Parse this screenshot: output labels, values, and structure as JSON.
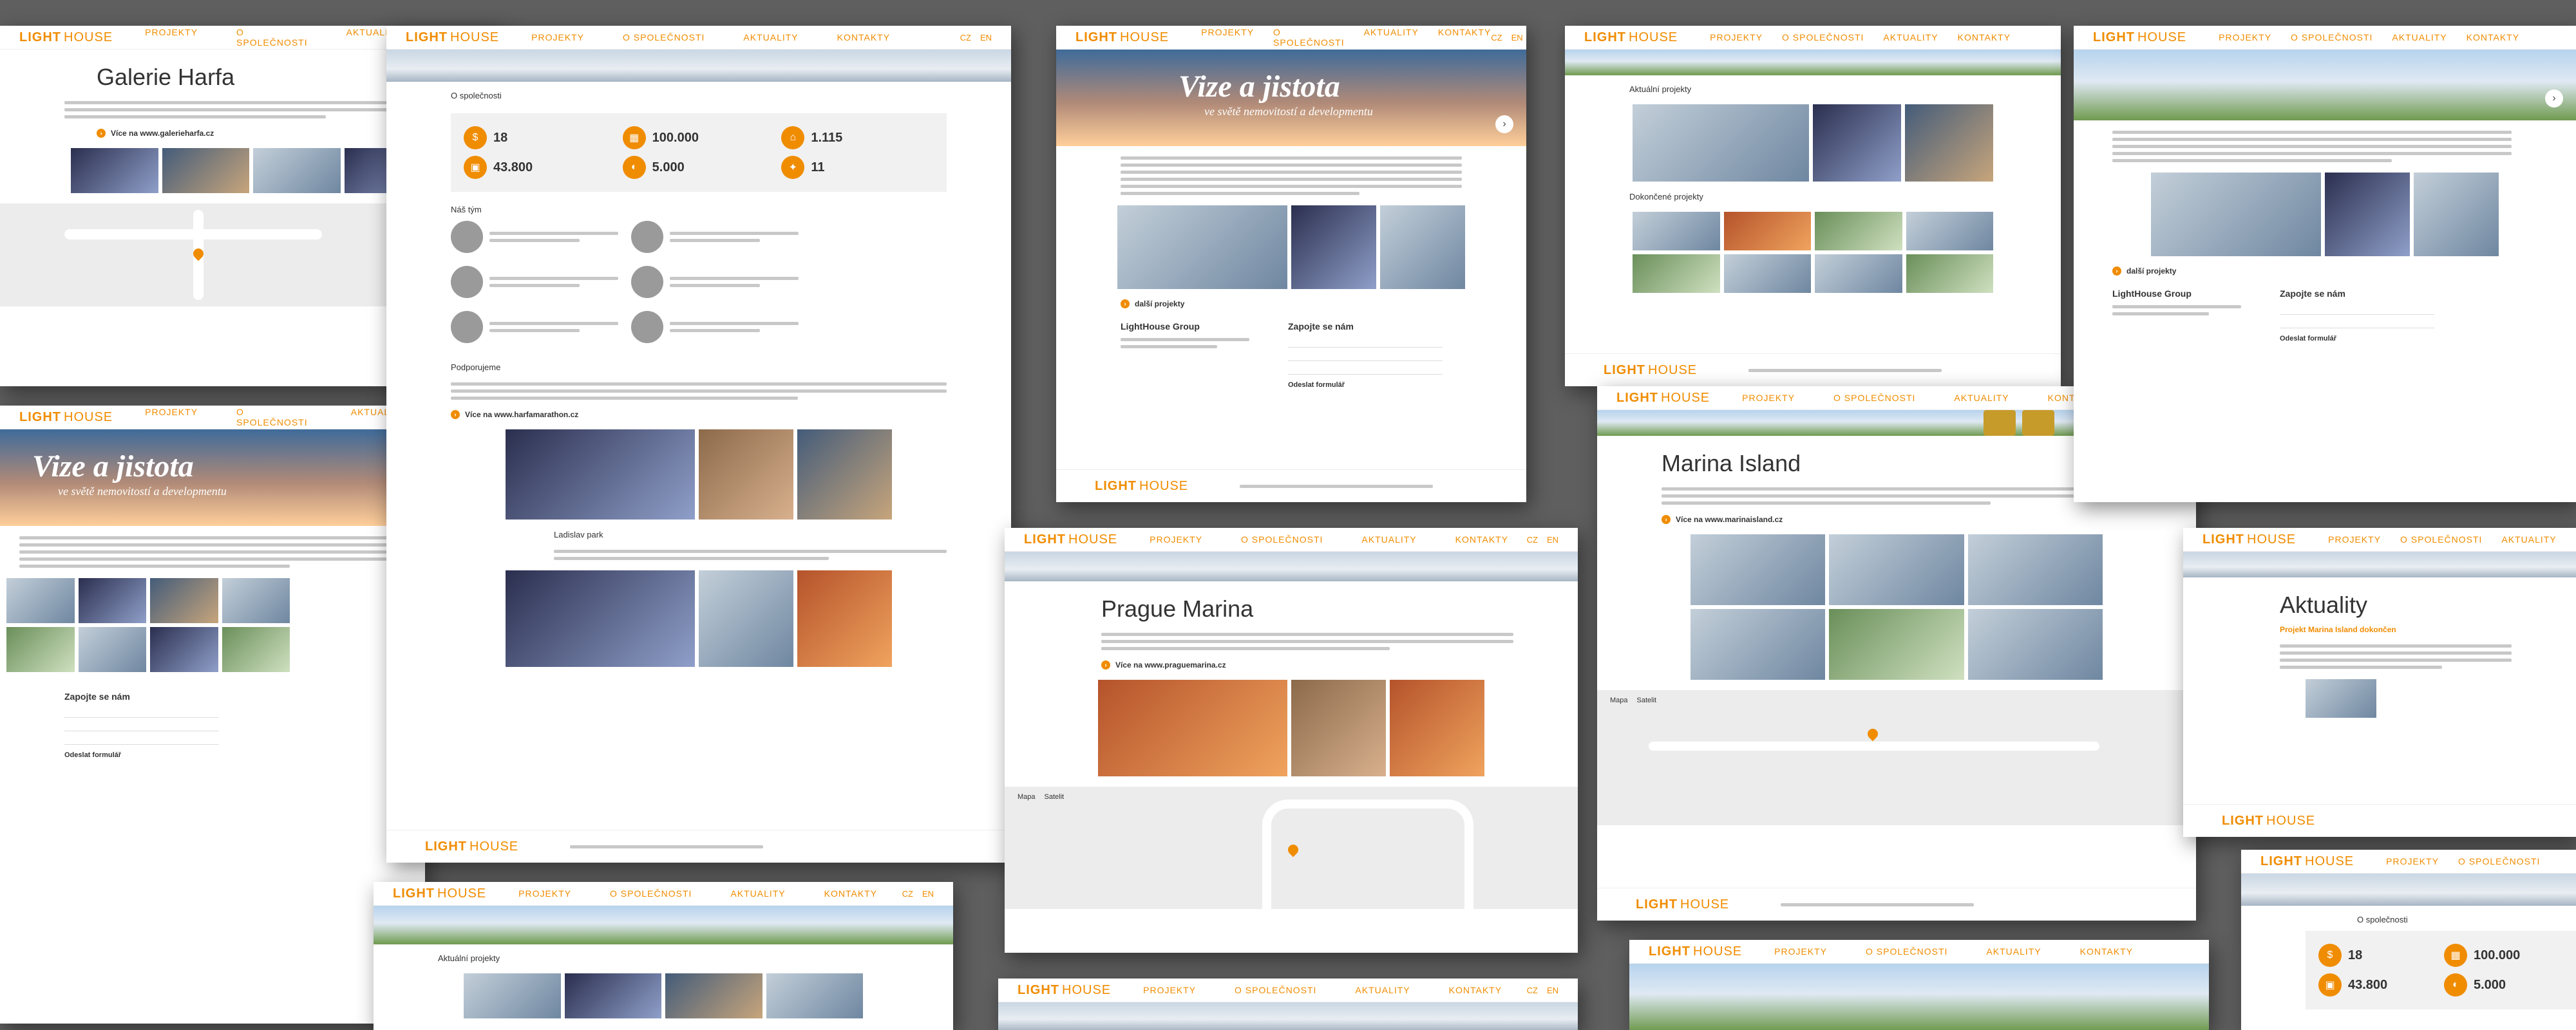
{
  "nav": {
    "logo_light": "LIGHT",
    "logo_house": "HOUSE",
    "menu": [
      "PROJEKTY",
      "O SPOLEČNOSTI",
      "AKTUALITY",
      "KONTAKTY"
    ],
    "lang": [
      "CZ",
      "EN"
    ]
  },
  "hero": {
    "title": "Vize a jistota",
    "subtitle": "ve světě nemovitostí a developmentu"
  },
  "pages": {
    "harfa": {
      "title": "Galerie Harfa",
      "link": "Více na www.galerieharfa.cz"
    },
    "marina": {
      "title": "Prague Marina",
      "link": "Více na www.praguemarina.cz"
    },
    "island": {
      "title": "Marina Island",
      "link": "Více na www.marinaisland.cz"
    },
    "news": {
      "title": "Aktuality",
      "kicker": "Projekt Marina Island dokončen"
    }
  },
  "company": {
    "heading": "O společnosti",
    "team_heading": "Náš tým",
    "stats": [
      {
        "icon": "money-bag-icon",
        "value": "18"
      },
      {
        "icon": "building-icon",
        "value": "100.000"
      },
      {
        "icon": "home-icon",
        "value": "1.115"
      },
      {
        "icon": "briefcase-icon",
        "value": "43.800"
      },
      {
        "icon": "car-icon",
        "value": "5.000"
      },
      {
        "icon": "handshake-icon",
        "value": "11"
      }
    ],
    "sponsoring": "Podporujeme",
    "sponsor_link": "Více na www.harfamarathon.cz",
    "sponsor2": "Ladislav park"
  },
  "projects": {
    "current": "Aktuální projekty",
    "completed": "Dokončené projekty",
    "more": "další projekty"
  },
  "contact": {
    "company": "LightHouse Group",
    "form_heading": "Zapojte se nám",
    "submit": "Odeslat formulář"
  },
  "map": {
    "tab_map": "Mapa",
    "tab_sat": "Satelit"
  }
}
